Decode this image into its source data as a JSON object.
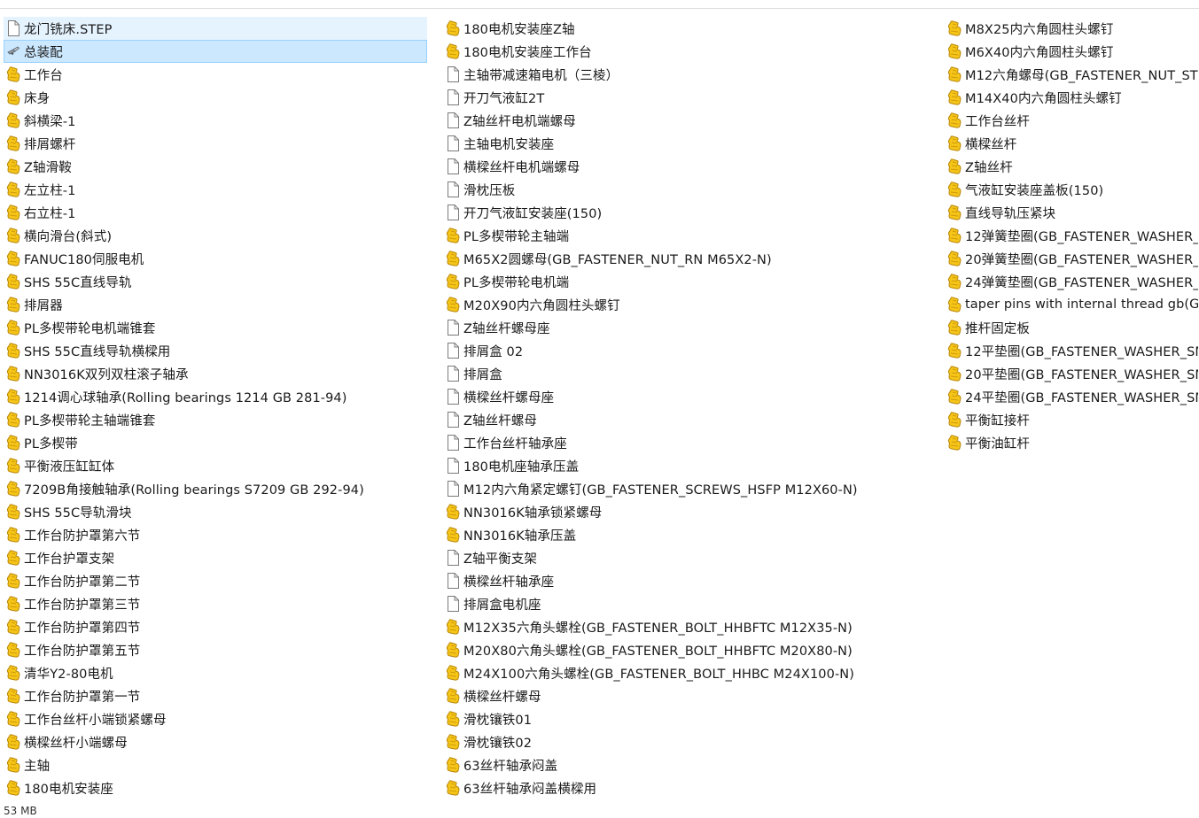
{
  "files": {
    "column1": [
      {
        "name": "龙门铣床.STEP",
        "icon": "blank-file-icon"
      },
      {
        "name": "总装配",
        "icon": "assembly-icon"
      },
      {
        "name": "工作台",
        "icon": "part-icon"
      },
      {
        "name": "床身",
        "icon": "part-icon"
      },
      {
        "name": "斜横梁-1",
        "icon": "part-icon"
      },
      {
        "name": "排屑螺杆",
        "icon": "part-icon"
      },
      {
        "name": "Z轴滑鞍",
        "icon": "part-icon"
      },
      {
        "name": "左立柱-1",
        "icon": "part-icon"
      },
      {
        "name": "右立柱-1",
        "icon": "part-icon"
      },
      {
        "name": "横向滑台(斜式)",
        "icon": "part-icon"
      },
      {
        "name": "FANUC180伺服电机",
        "icon": "part-icon"
      },
      {
        "name": "SHS 55C直线导轨",
        "icon": "part-icon"
      },
      {
        "name": "排屑器",
        "icon": "part-icon"
      },
      {
        "name": "PL多楔带轮电机端锥套",
        "icon": "part-icon"
      },
      {
        "name": "SHS 55C直线导轨横樑用",
        "icon": "part-icon"
      },
      {
        "name": "NN3016K双列双柱滚子轴承",
        "icon": "part-icon"
      },
      {
        "name": "1214调心球轴承(Rolling bearings 1214 GB 281-94)",
        "icon": "part-icon"
      },
      {
        "name": "PL多楔带轮主轴端锥套",
        "icon": "part-icon"
      },
      {
        "name": "PL多楔带",
        "icon": "part-icon"
      },
      {
        "name": "平衡液压缸缸体",
        "icon": "part-icon"
      },
      {
        "name": "7209B角接触轴承(Rolling bearings S7209 GB 292-94)",
        "icon": "part-icon"
      },
      {
        "name": "SHS 55C导轨滑块",
        "icon": "part-icon"
      },
      {
        "name": "工作台防护罩第六节",
        "icon": "part-icon"
      },
      {
        "name": "工作台护罩支架",
        "icon": "part-icon"
      },
      {
        "name": "工作台防护罩第二节",
        "icon": "part-icon"
      },
      {
        "name": "工作台防护罩第三节",
        "icon": "part-icon"
      },
      {
        "name": "工作台防护罩第四节",
        "icon": "part-icon"
      },
      {
        "name": "工作台防护罩第五节",
        "icon": "part-icon"
      },
      {
        "name": "清华Y2-80电机",
        "icon": "part-icon"
      },
      {
        "name": "工作台防护罩第一节",
        "icon": "part-icon"
      },
      {
        "name": "工作台丝杆小端锁紧螺母",
        "icon": "part-icon"
      },
      {
        "name": "横樑丝杆小端螺母",
        "icon": "part-icon"
      },
      {
        "name": "主轴",
        "icon": "part-icon"
      },
      {
        "name": "180电机安装座",
        "icon": "part-icon"
      }
    ],
    "column2": [
      {
        "name": "180电机安装座Z轴",
        "icon": "part-icon"
      },
      {
        "name": "180电机安装座工作台",
        "icon": "part-icon"
      },
      {
        "name": "主轴带减速箱电机（三棱）",
        "icon": "blank-file-icon"
      },
      {
        "name": "开刀气液缸2T",
        "icon": "blank-file-icon"
      },
      {
        "name": "Z轴丝杆电机端螺母",
        "icon": "blank-file-icon"
      },
      {
        "name": "主轴电机安装座",
        "icon": "blank-file-icon"
      },
      {
        "name": "横樑丝杆电机端螺母",
        "icon": "blank-file-icon"
      },
      {
        "name": "滑枕压板",
        "icon": "blank-file-icon"
      },
      {
        "name": "开刀气液缸安装座(150)",
        "icon": "blank-file-icon"
      },
      {
        "name": "PL多楔带轮主轴端",
        "icon": "part-icon"
      },
      {
        "name": "M65X2圆螺母(GB_FASTENER_NUT_RN M65X2-N)",
        "icon": "part-icon"
      },
      {
        "name": "PL多楔带轮电机端",
        "icon": "part-icon"
      },
      {
        "name": "M20X90内六角圆柱头螺钉",
        "icon": "part-icon"
      },
      {
        "name": "Z轴丝杆螺母座",
        "icon": "blank-file-icon"
      },
      {
        "name": "排屑盒 02",
        "icon": "blank-file-icon"
      },
      {
        "name": "排屑盒",
        "icon": "blank-file-icon"
      },
      {
        "name": "横樑丝杆螺母座",
        "icon": "blank-file-icon"
      },
      {
        "name": "Z轴丝杆螺母",
        "icon": "blank-file-icon"
      },
      {
        "name": "工作台丝杆轴承座",
        "icon": "blank-file-icon"
      },
      {
        "name": "180电机座轴承压盖",
        "icon": "blank-file-icon"
      },
      {
        "name": "M12内六角紧定螺钉(GB_FASTENER_SCREWS_HSFP M12X60-N)",
        "icon": "blank-file-icon"
      },
      {
        "name": "NN3016K轴承锁紧螺母",
        "icon": "part-icon"
      },
      {
        "name": "NN3016K轴承压盖",
        "icon": "part-icon"
      },
      {
        "name": "Z轴平衡支架",
        "icon": "blank-file-icon"
      },
      {
        "name": "横樑丝杆轴承座",
        "icon": "blank-file-icon"
      },
      {
        "name": "排屑盒电机座",
        "icon": "blank-file-icon"
      },
      {
        "name": "M12X35六角头螺栓(GB_FASTENER_BOLT_HHBFTC M12X35-N)",
        "icon": "part-icon"
      },
      {
        "name": "M20X80六角头螺栓(GB_FASTENER_BOLT_HHBFTC M20X80-N)",
        "icon": "part-icon"
      },
      {
        "name": "M24X100六角头螺栓(GB_FASTENER_BOLT_HHBC M24X100-N)",
        "icon": "part-icon"
      },
      {
        "name": "横樑丝杆螺母",
        "icon": "part-icon"
      },
      {
        "name": "滑枕镶铁01",
        "icon": "part-icon"
      },
      {
        "name": "滑枕镶铁02",
        "icon": "part-icon"
      },
      {
        "name": "63丝杆轴承闷盖",
        "icon": "part-icon"
      },
      {
        "name": "63丝杆轴承闷盖横樑用",
        "icon": "part-icon"
      }
    ],
    "column3": [
      {
        "name": "M8X25内六角圆柱头螺钉",
        "icon": "part-icon"
      },
      {
        "name": "M6X40内六角圆柱头螺钉",
        "icon": "part-icon"
      },
      {
        "name": "M12六角螺母(GB_FASTENER_NUT_ST",
        "icon": "part-icon"
      },
      {
        "name": "M14X40内六角圆柱头螺钉",
        "icon": "part-icon"
      },
      {
        "name": "工作台丝杆",
        "icon": "part-icon"
      },
      {
        "name": "横樑丝杆",
        "icon": "part-icon"
      },
      {
        "name": "Z轴丝杆",
        "icon": "part-icon"
      },
      {
        "name": "气液缸安装座盖板(150)",
        "icon": "part-icon"
      },
      {
        "name": "直线导轨压紧块",
        "icon": "part-icon"
      },
      {
        "name": "12弹簧垫圈(GB_FASTENER_WASHER_",
        "icon": "part-icon"
      },
      {
        "name": "20弹簧垫圈(GB_FASTENER_WASHER_",
        "icon": "part-icon"
      },
      {
        "name": "24弹簧垫圈(GB_FASTENER_WASHER_",
        "icon": "part-icon"
      },
      {
        "name": "taper pins with internal thread gb(GE",
        "icon": "part-icon"
      },
      {
        "name": "推杆固定板",
        "icon": "part-icon"
      },
      {
        "name": "12平垫圈(GB_FASTENER_WASHER_SM",
        "icon": "part-icon"
      },
      {
        "name": "20平垫圈(GB_FASTENER_WASHER_SM",
        "icon": "part-icon"
      },
      {
        "name": "24平垫圈(GB_FASTENER_WASHER_SM",
        "icon": "part-icon"
      },
      {
        "name": "平衡缸接杆",
        "icon": "part-icon"
      },
      {
        "name": "平衡油缸杆",
        "icon": "part-icon"
      }
    ]
  },
  "state": {
    "hover_item": "龙门铣床.STEP",
    "selected_item": "总装配"
  },
  "status_bar": {
    "size_text": "53 MB"
  },
  "colors": {
    "selected_bg": "#cce8ff",
    "selected_border": "#99d1ff",
    "hover_bg": "#e5f3ff",
    "part_icon_yellow": "#f5c518",
    "part_icon_outline": "#b8860b"
  }
}
